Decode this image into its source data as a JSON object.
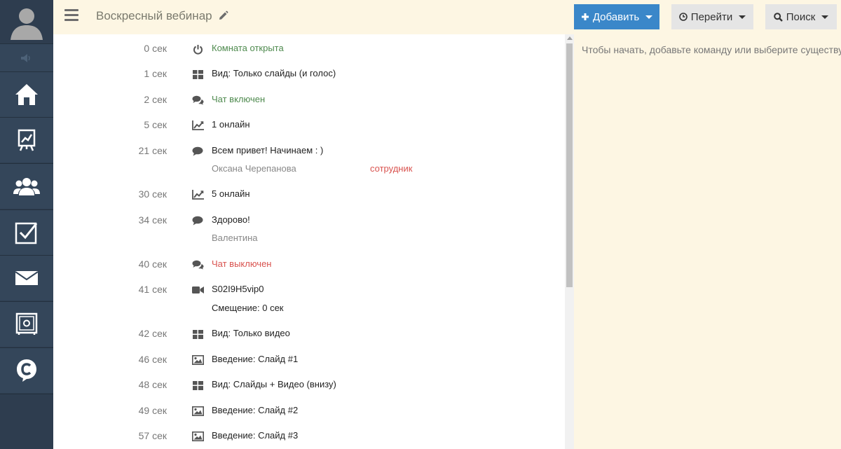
{
  "header": {
    "title": "Воскресный вебинар",
    "add_label": "Добавить",
    "go_label": "Перейти",
    "search_label": "Поиск"
  },
  "sidebar": {
    "items": [
      "home-icon",
      "presentation-icon",
      "users-icon",
      "checkbox-icon",
      "mail-icon",
      "safe-icon",
      "chat-c-icon"
    ]
  },
  "timeline": [
    {
      "time": "0 сек",
      "icon": "power-icon",
      "text": "Комната открыта",
      "tone": "green"
    },
    {
      "time": "1 сек",
      "icon": "layout-grid-icon",
      "text": "Вид: Только слайды (и голос)",
      "tone": "normal"
    },
    {
      "time": "2 сек",
      "icon": "chat-bubbles-icon",
      "text": "Чат включен",
      "tone": "green"
    },
    {
      "time": "5 сек",
      "icon": "chart-line-icon",
      "text": "1 онлайн",
      "tone": "normal"
    },
    {
      "time": "21 сек",
      "icon": "comment-icon",
      "text": "Всем привет! Начинаем : )",
      "tone": "normal",
      "author": "Оксана Черепанова",
      "role": "сотрудник"
    },
    {
      "time": "30 сек",
      "icon": "chart-line-icon",
      "text": "5 онлайн",
      "tone": "normal"
    },
    {
      "time": "34 сек",
      "icon": "comment-icon",
      "text": "Здорово!",
      "tone": "normal",
      "author": "Валентина"
    },
    {
      "time": "40 сек",
      "icon": "chat-bubbles-icon",
      "text": "Чат выключен",
      "tone": "red"
    },
    {
      "time": "41 сек",
      "icon": "video-camera-icon",
      "text": "S02I9H5vip0",
      "tone": "normal",
      "offset": "Смещение: 0 сек"
    },
    {
      "time": "42 сек",
      "icon": "layout-grid-icon",
      "text": "Вид: Только видео",
      "tone": "normal"
    },
    {
      "time": "46 сек",
      "icon": "image-icon",
      "text": "Введение: Слайд #1",
      "tone": "normal"
    },
    {
      "time": "48 сек",
      "icon": "layout-grid-icon",
      "text": "Вид: Слайды + Видео (внизу)",
      "tone": "normal"
    },
    {
      "time": "49 сек",
      "icon": "image-icon",
      "text": "Введение: Слайд #2",
      "tone": "normal"
    },
    {
      "time": "57 сек",
      "icon": "image-icon",
      "text": "Введение: Слайд #3",
      "tone": "normal"
    }
  ],
  "right_panel": {
    "hint": "Чтобы начать, добавьте команду или выберите существующую"
  },
  "colors": {
    "sidebar": "#2e3d4f",
    "accent": "#3a87c9",
    "header_bg": "#fdf6e3",
    "green": "#4e8a4e",
    "red": "#d9534f"
  }
}
